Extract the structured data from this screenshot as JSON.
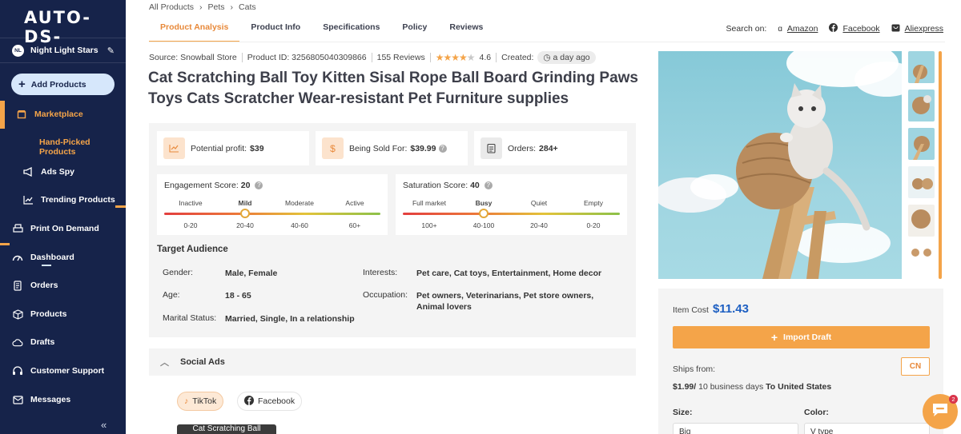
{
  "brand": {
    "logo": "AUTO-DS-"
  },
  "store": {
    "initials": "NL",
    "name": "Night Light Stars"
  },
  "sidebar": {
    "add_label": "Add Products",
    "marketplace": "Marketplace",
    "items": [
      {
        "label": "Hand-Picked Products"
      },
      {
        "label": "Ads Spy"
      },
      {
        "label": "Trending Products"
      },
      {
        "label": "Print On Demand"
      },
      {
        "label": "Dashboard"
      },
      {
        "label": "Orders"
      },
      {
        "label": "Products"
      },
      {
        "label": "Drafts"
      },
      {
        "label": "Customer Support"
      },
      {
        "label": "Messages"
      }
    ],
    "collapse": "«"
  },
  "breadcrumb": [
    "All Products",
    "Pets",
    "Cats"
  ],
  "tabs": [
    "Product Analysis",
    "Product Info",
    "Specifications",
    "Policy",
    "Reviews"
  ],
  "search_on": {
    "label": "Search on:",
    "links": [
      "Amazon",
      "Facebook",
      "Aliexpress"
    ]
  },
  "meta": {
    "source": "Source: Snowball Store",
    "product_id": "Product ID: 3256805040309866",
    "reviews": "155 Reviews",
    "rating": "4.6",
    "rating_value": 4.6,
    "created_label": "Created:",
    "created_value": "a day ago"
  },
  "product_title": "Cat Scratching Ball Toy Kitten Sisal Rope Ball Board Grinding Paws Toys Cats Scratcher Wear-resistant Pet Furniture supplies",
  "kpis": {
    "profit_label": "Potential profit:",
    "profit_value": "$39",
    "sold_label": "Being Sold For:",
    "sold_value": "$39.99",
    "orders_label": "Orders:",
    "orders_value": "284+"
  },
  "engagement": {
    "label": "Engagement Score:",
    "value": "20",
    "levels": [
      "Inactive",
      "Mild",
      "Moderate",
      "Active"
    ],
    "ranges": [
      "0-20",
      "20-40",
      "40-60",
      "60+"
    ],
    "highlight": "Mild"
  },
  "saturation": {
    "label": "Saturation Score:",
    "value": "40",
    "levels": [
      "Full market",
      "Busy",
      "Quiet",
      "Empty"
    ],
    "ranges": [
      "100+",
      "40-100",
      "20-40",
      "0-20"
    ],
    "highlight": "Busy"
  },
  "audience": {
    "title": "Target Audience",
    "gender_label": "Gender:",
    "gender": "Male, Female",
    "age_label": "Age:",
    "age": "18 - 65",
    "marital_label": "Marital Status:",
    "marital": "Married, Single, In a relationship",
    "interests_label": "Interests:",
    "interests": "Pet care, Cat toys, Entertainment, Home decor",
    "occupation_label": "Occupation:",
    "occupation": "Pet owners, Veterinarians, Pet store owners, Animal lovers"
  },
  "social_ads": {
    "title": "Social Ads",
    "tiktok": "TikTok",
    "facebook": "Facebook",
    "video_caption": "Cat Scratching Ball"
  },
  "purchase": {
    "item_cost_label": "Item Cost",
    "item_cost": "$11.43",
    "import_label": "Import Draft",
    "ships_from_label": "Ships from:",
    "ships_from_code": "CN",
    "shipping_price": "$1.99/",
    "shipping_days": " 10 business days ",
    "shipping_dest": "To United States",
    "size_label": "Size:",
    "size_value": "Big",
    "color_label": "Color:",
    "color_value": "V type"
  },
  "chat": {
    "badge": "2"
  },
  "colors": {
    "accent": "#f4a449",
    "sidebar": "#16234a",
    "price": "#1d5fc2"
  }
}
